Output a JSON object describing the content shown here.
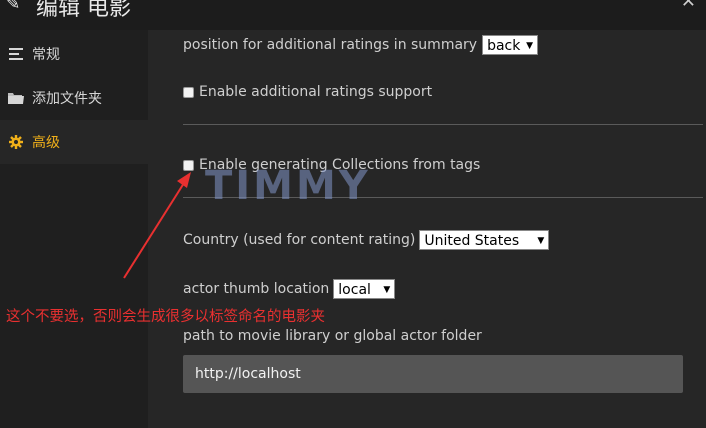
{
  "header": {
    "title": "编辑 电影"
  },
  "sidebar": {
    "items": [
      {
        "label": "常规",
        "icon": "list-icon"
      },
      {
        "label": "添加文件夹",
        "icon": "folder-icon"
      },
      {
        "label": "高级",
        "icon": "gear-icon",
        "active": true
      }
    ]
  },
  "main": {
    "ratings_position": {
      "label": "position for additional ratings in summary",
      "value": "back"
    },
    "additional_ratings": {
      "label": "Enable additional ratings support",
      "checked": false
    },
    "collections_from_tags": {
      "label": "Enable generating Collections from tags",
      "checked": false
    },
    "country": {
      "label": "Country (used for content rating)",
      "value": "United States"
    },
    "actor_thumb": {
      "label": "actor thumb location",
      "value": "local"
    },
    "library_path": {
      "label": "path to movie library or global actor folder",
      "value": "http://localhost"
    }
  },
  "overlay": {
    "watermark": "TIMMY",
    "annotation": "这个不要选，否则会生成很多以标签命名的电影夹"
  },
  "colors": {
    "accent": "#f0b01a",
    "annotation_red": "#e83030",
    "background": "#262626"
  }
}
